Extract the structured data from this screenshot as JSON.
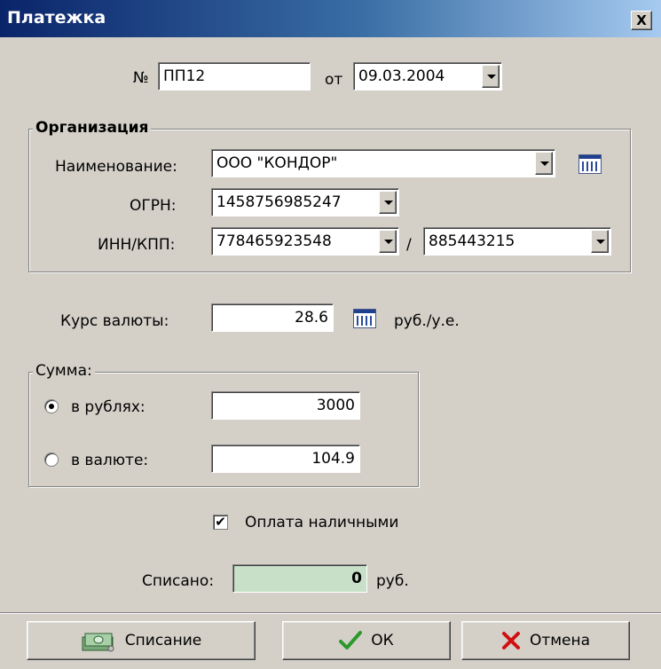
{
  "window": {
    "title": "Платежка",
    "close_label": "X"
  },
  "header": {
    "number_label": "№",
    "number_value": "ПП12",
    "date_label": "от",
    "date_value": "09.03.2004"
  },
  "org": {
    "group_title": "Организация",
    "name_label": "Наименование:",
    "name_value": "ООО \"КОНДОР\"",
    "ogrn_label": "ОГРН:",
    "ogrn_value": "1458756985247",
    "innkpp_label": "ИНН/КПП:",
    "inn_value": "778465923548",
    "separator": "/",
    "kpp_value": "885443215"
  },
  "rate": {
    "label": "Курс валюты:",
    "value": "28.6",
    "unit": "руб./у.е."
  },
  "sum": {
    "group_title": "Сумма:",
    "rub_label": "в рублях:",
    "rub_value": "3000",
    "cur_label": "в валюте:",
    "cur_value": "104.9",
    "selected": "rub"
  },
  "cash": {
    "label": "Оплата наличными",
    "checked": true
  },
  "written_off": {
    "label": "Списано:",
    "value": "0",
    "unit": "руб."
  },
  "buttons": {
    "writeoff": "Списание",
    "ok": "ОК",
    "cancel": "Отмена"
  },
  "colors": {
    "title_start": "#0a246a",
    "title_end": "#a6caf0",
    "face": "#d4d0c8",
    "writeoff_field": "#c8e0c8",
    "ok_check": "#2a9a2a",
    "cancel_x": "#d01010"
  },
  "icons": [
    "calendar-table-icon",
    "money-icon",
    "checkmark-icon",
    "cross-icon"
  ]
}
